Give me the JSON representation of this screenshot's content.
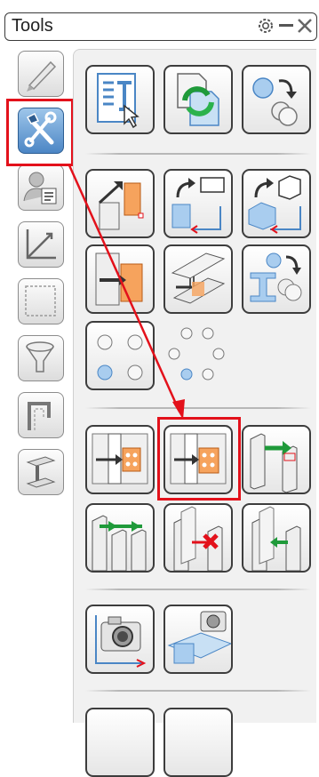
{
  "window": {
    "title": "Tools"
  },
  "titlebar_icons": [
    "gear-icon",
    "minimize-icon",
    "close-icon"
  ],
  "sidebar": {
    "items": [
      {
        "name": "pencil-tool-icon"
      },
      {
        "name": "tools-icon",
        "active": true
      },
      {
        "name": "user-properties-icon"
      },
      {
        "name": "axes-icon"
      },
      {
        "name": "dashed-square-icon"
      },
      {
        "name": "funnel-icon"
      },
      {
        "name": "bent-profile-icon"
      },
      {
        "name": "steel-beam-icon"
      }
    ]
  },
  "tools": [
    {
      "name": "report-template-icon"
    },
    {
      "name": "copy-refresh-icon"
    },
    {
      "name": "shapes-transform-icon"
    },
    {
      "name": "column-adjust-icon"
    },
    {
      "name": "rotate-plane-icon"
    },
    {
      "name": "rotate-box-icon"
    },
    {
      "name": "beam-push-icon"
    },
    {
      "name": "beam-section-icon"
    },
    {
      "name": "profile-shapes-icon"
    },
    {
      "name": "bolt-pattern-square-icon"
    },
    {
      "name": "bolt-pattern-circle-icon"
    },
    {
      "name": "end-plate-connection-icon"
    },
    {
      "name": "end-plate-connection-alt-icon"
    },
    {
      "name": "beam-column-connection-icon"
    },
    {
      "name": "multi-column-connection-icon"
    },
    {
      "name": "remove-connection-icon"
    },
    {
      "name": "column-link-icon"
    },
    {
      "name": "camera-icon"
    },
    {
      "name": "camera-beam-icon"
    }
  ],
  "annotation": {
    "color": "#e3111b"
  }
}
